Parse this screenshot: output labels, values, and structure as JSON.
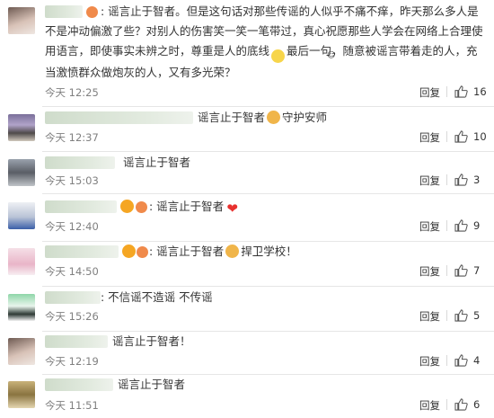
{
  "comments": [
    {
      "text": ": 谣言止于智者。但是这句话对那些传谣的人似乎不痛不痒，昨天那么多人是不是冲动偏激了些？对别人的伤害笑一笑一笔带过，真心祝愿那些人学会在网络上合理使用语言，即使事实未辨之时，尊重是人的底线",
      "text_after_emoji": "最后一句，随意被谣言带着走的人，充当激愤群众做炮灰的人，又有多光荣？",
      "time": "今天 12:25",
      "reply": "回复",
      "likes": "16"
    },
    {
      "text": "谣言止于智者",
      "text_after_emoji": "守护安师",
      "time": "今天 12:37",
      "reply": "回复",
      "likes": "10"
    },
    {
      "text": "谣言止于智者",
      "time": "今天 15:03",
      "reply": "回复",
      "likes": "3"
    },
    {
      "text": ": 谣言止于智者",
      "time": "今天 12:40",
      "reply": "回复",
      "likes": "9"
    },
    {
      "text": ": 谣言止于智者",
      "text_after_emoji": "捍卫学校！",
      "time": "今天 14:50",
      "reply": "回复",
      "likes": "7"
    },
    {
      "text": ": 不信谣不造谣 不传谣",
      "time": "今天 15:26",
      "reply": "回复",
      "likes": "5"
    },
    {
      "text": "谣言止于智者！",
      "time": "今天 12:19",
      "reply": "回复",
      "likes": "4"
    },
    {
      "text": "谣言止于智者",
      "time": "今天 11:51",
      "reply": "回复",
      "likes": "6"
    }
  ],
  "colors": {
    "muscle_emoji": "#f0b54a",
    "heart_emoji": "#e8312f",
    "smile_emoji": "#f7d54a",
    "divider": "#e6e6e6",
    "time": "#808080"
  },
  "icons": {
    "like": "thumbs-up-icon"
  }
}
